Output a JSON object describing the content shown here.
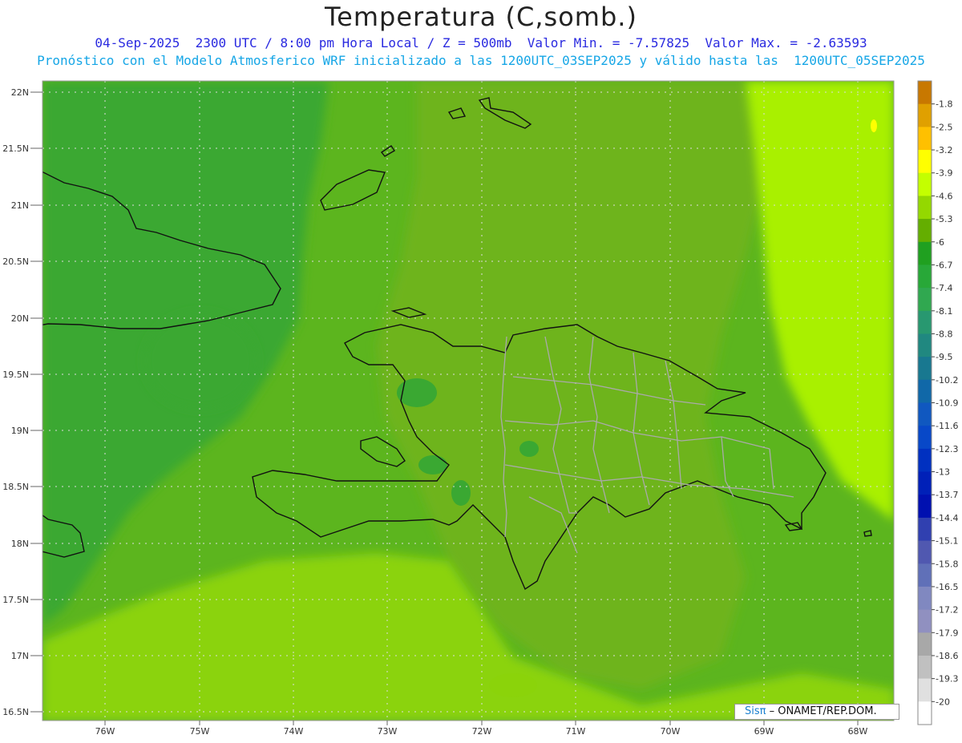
{
  "title": "Temperatura (C,somb.)",
  "subtitle_line1": "04-Sep-2025  2300 UTC / 8:00 pm Hora Local / Z = 500mb  Valor Min. = -7.57825  Valor Max. = -2.63593",
  "subtitle_line2": "Pronóstico con el Modelo Atmosferico WRF inicializado a las 1200UTC_03SEP2025 y válido hasta las  1200UTC_05SEP2025",
  "map": {
    "lat_labels": [
      "22N",
      "21.5N",
      "21N",
      "20.5N",
      "20N",
      "19.5N",
      "19N",
      "18.5N",
      "18N",
      "17.5N",
      "17N",
      "16.5N"
    ],
    "lon_labels": [
      "76W",
      "75W",
      "74W",
      "73W",
      "72W",
      "71W",
      "70W",
      "69W",
      "68W"
    ],
    "grid": true,
    "colors": {
      "dark_green": "#3aa832",
      "mid_green": "#5cb51e",
      "olive_green": "#6eb41a",
      "lime": "#8bd30a",
      "light_lime": "#a9f000",
      "outline": "#111111",
      "province_lines": "#aaaaaa"
    }
  },
  "colorbar": {
    "labels": [
      "-1.8",
      "-2.5",
      "-3.2",
      "-3.9",
      "-4.6",
      "-5.3",
      "-6",
      "-6.7",
      "-7.4",
      "-8.1",
      "-8.8",
      "-9.5",
      "-10.2",
      "-10.9",
      "-11.6",
      "-12.3",
      "-13",
      "-13.7",
      "-14.4",
      "-15.1",
      "-15.8",
      "-16.5",
      "-17.2",
      "-17.9",
      "-18.6",
      "-19.3",
      "-20"
    ],
    "colors": [
      "#c87800",
      "#e0a000",
      "#ffc000",
      "#ffff00",
      "#c4ff00",
      "#94d800",
      "#64ae00",
      "#20a020",
      "#28a838",
      "#30a850",
      "#289870",
      "#208880",
      "#187890",
      "#1068a8",
      "#1058c0",
      "#0848c8",
      "#0030c0",
      "#0020b8",
      "#0010b0",
      "#3040b0",
      "#5058b0",
      "#6070b8",
      "#8088c0",
      "#9090c0",
      "#a8a8a8",
      "#c0c0c0",
      "#e0e0e0",
      "#ffffff"
    ]
  },
  "credit": {
    "brand": "Sisπ",
    "text": " – ONAMET/REP.DOM."
  }
}
